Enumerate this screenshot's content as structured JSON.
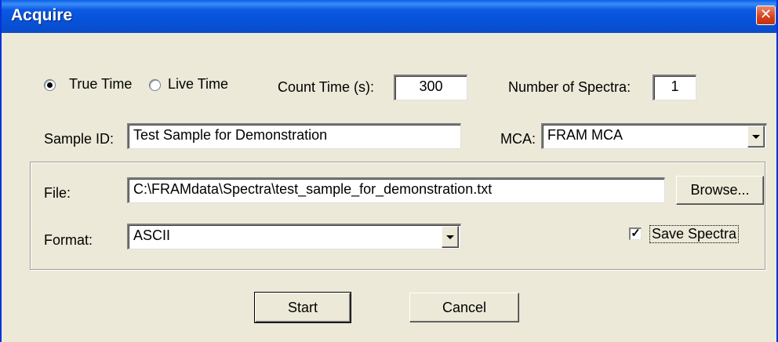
{
  "window": {
    "title": "Acquire",
    "close_icon": "close-icon"
  },
  "timing": {
    "true_time_label": "True Time",
    "true_time_selected": true,
    "live_time_label": "Live Time",
    "live_time_selected": false,
    "count_time_label": "Count Time (s):",
    "count_time_value": "300",
    "num_spectra_label": "Number of Spectra:",
    "num_spectra_value": "1"
  },
  "sample": {
    "id_label": "Sample ID:",
    "id_value": "Test Sample for Demonstration",
    "mca_label": "MCA:",
    "mca_selected": "FRAM MCA"
  },
  "file_group": {
    "file_label": "File:",
    "file_path": "C:\\FRAMdata\\Spectra\\test_sample_for_demonstration.txt",
    "browse_label": "Browse...",
    "format_label": "Format:",
    "format_selected": "ASCII",
    "save_spectra_label": "Save Spectra",
    "save_spectra_checked": true
  },
  "buttons": {
    "start": "Start",
    "cancel": "Cancel"
  }
}
